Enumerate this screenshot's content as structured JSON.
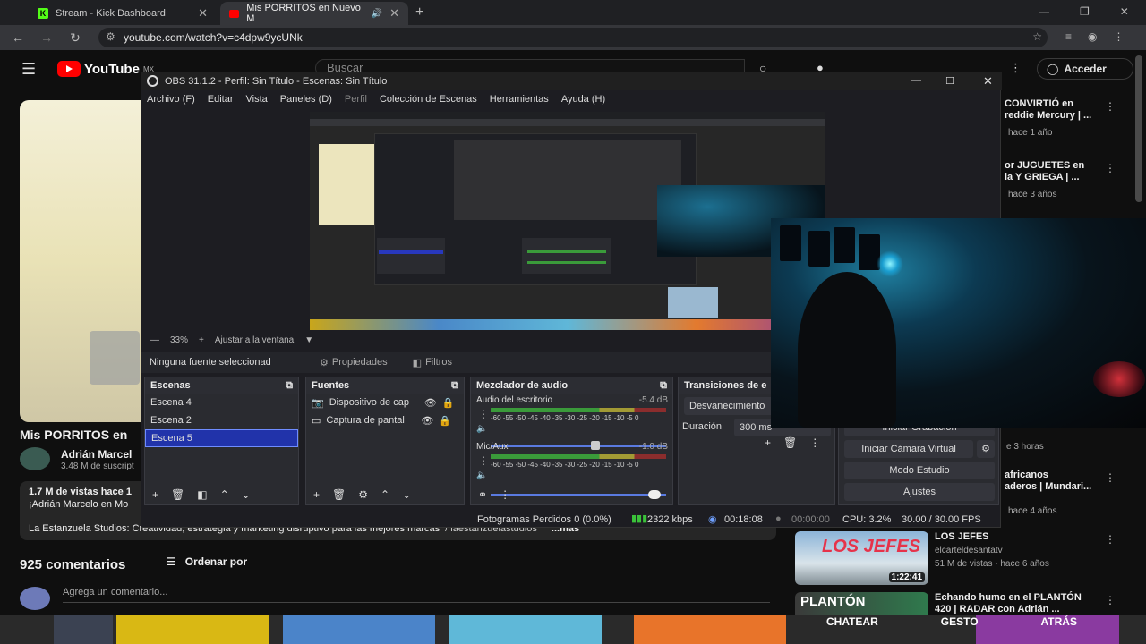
{
  "browser": {
    "tabs": [
      {
        "label": "Stream - Kick Dashboard",
        "icon": "kick-icon"
      },
      {
        "label": "Mis PORRITOS en Nuevo M",
        "icon": "youtube-icon"
      }
    ],
    "url": "youtube.com/watch?v=c4dpw9ycUNk"
  },
  "youtube": {
    "logo": "YouTube",
    "country": "MX",
    "search_placeholder": "Buscar",
    "signin": "Acceder",
    "video_title": "Mis PORRITOS en",
    "channel": "Adrián Marcel",
    "subs": "3.48 M de suscript",
    "views": "1.7 M de vistas  hace 1",
    "desc1": "¡Adrián Marcelo en Mo",
    "desc2": "La Estanzuela Studios: Creatividad, estrategia y marketing disruptivo para las mejores marcas",
    "desc_handle": "/ laestanzuelastudios",
    "more": "...más",
    "comments": "925 comentarios",
    "sort": "Ordenar por",
    "add_comment": "Agrega un comentario...",
    "sidebar": [
      {
        "title": "CONVIRTIÓ en",
        "title2": "reddie Mercury | ...",
        "meta": "hace 1 año"
      },
      {
        "title": "or JUGUETES en",
        "title2": "la Y GRIEGA | ...",
        "meta": "hace 3 años"
      },
      {
        "title": "",
        "title2": "",
        "meta": "e 3 horas"
      },
      {
        "title": "africanos",
        "title2": "aderos | Mundari...",
        "meta": "hace 4 años"
      },
      {
        "title": "LOS JEFES",
        "title2": "elcarteldesantatv",
        "meta": "51 M de vistas · hace 6 años",
        "duration": "1:22:41"
      },
      {
        "title": "Echando humo en el PLANTÓN",
        "title2": "420 | RADAR con Adrián ...",
        "meta": ""
      }
    ],
    "bottom_labels": [
      "CHATEAR",
      "GESTO",
      "ATRÁS"
    ]
  },
  "obs": {
    "title": "OBS 31.1.2 - Perfil: Sin Título - Escenas: Sin Título",
    "menu": [
      "Archivo (F)",
      "Editar",
      "Vista",
      "Paneles (D)",
      "Perfil",
      "Colección de Escenas",
      "Herramientas",
      "Ayuda (H)"
    ],
    "zoom": "33%",
    "fit": "Ajustar a la ventana",
    "no_source": "Ninguna fuente seleccionad",
    "properties": "Propiedades",
    "filters": "Filtros",
    "scenes_title": "Escenas",
    "scenes": [
      "Escena 4",
      "Escena 2",
      "Escena 5"
    ],
    "sources_title": "Fuentes",
    "sources": [
      "Dispositivo de cap",
      "Captura de pantal"
    ],
    "mixer_title": "Mezclador de audio",
    "mixer": [
      {
        "name": "Audio del escritorio",
        "db": "-5.4 dB",
        "level": 0.62
      },
      {
        "name": "Mic/Aux",
        "db": "-1.0 dB",
        "level": 0.97
      }
    ],
    "meter_scale": "-60 -55 -50 -45 -40 -35 -30 -25 -20 -15 -10 -5  0",
    "transitions_title": "Transiciones de e",
    "transition": "Desvanecimiento",
    "duration_label": "Duración",
    "duration": "300 ms",
    "controls": [
      "Iniciar Cámara Virtual",
      "Modo Estudio",
      "Ajustes"
    ],
    "start_recording": "Iniciar Grabación",
    "status": {
      "dropped": "Fotogramas Perdidos 0 (0.0%)",
      "kbps": "2322 kbps",
      "live_time": "00:18:08",
      "rec_time": "00:00:00",
      "cpu": "CPU: 3.2%",
      "fps": "30.00 / 30.00 FPS"
    }
  }
}
